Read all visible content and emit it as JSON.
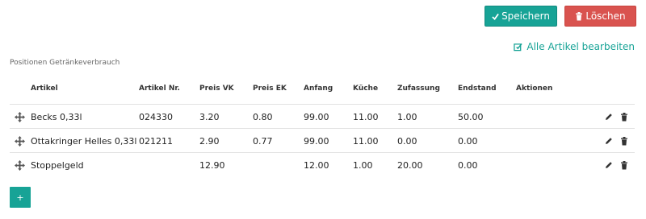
{
  "toolbar": {
    "save_label": "Speichern",
    "delete_label": "Löschen",
    "save_icon": "check-icon",
    "delete_icon": "trash-icon",
    "save_color": "#17a396",
    "delete_color": "#d9534f"
  },
  "edit_all": {
    "label": "Alle Artikel bearbeiten",
    "icon": "edit-square-icon",
    "color": "#17a396"
  },
  "section_label": "Positionen Getränkeverbrauch",
  "table": {
    "headers": [
      "Artikel",
      "Artikel Nr.",
      "Preis VK",
      "Preis EK",
      "Anfang",
      "Küche",
      "Zufassung",
      "Endstand",
      "Aktionen"
    ],
    "rows": [
      {
        "artikel": "Becks 0,33l",
        "artikel_nr": "024330",
        "preis_vk": "3.20",
        "preis_ek": "0.80",
        "anfang": "99.00",
        "kueche": "11.00",
        "zufassung": "1.00",
        "endstand": "50.00"
      },
      {
        "artikel": "Ottakringer Helles 0,33l",
        "artikel_nr": "021211",
        "preis_vk": "2.90",
        "preis_ek": "0.77",
        "anfang": "99.00",
        "kueche": "11.00",
        "zufassung": "0.00",
        "endstand": "0.00"
      },
      {
        "artikel": "Stoppelgeld",
        "artikel_nr": "",
        "preis_vk": "12.90",
        "preis_ek": "",
        "anfang": "12.00",
        "kueche": "1.00",
        "zufassung": "20.00",
        "endstand": "0.00"
      }
    ]
  },
  "add_button": {
    "label": "+"
  }
}
